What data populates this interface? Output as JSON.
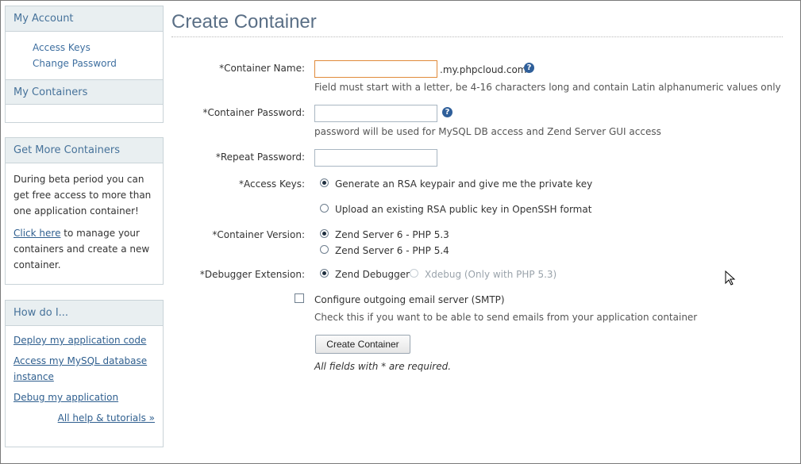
{
  "sidebar": {
    "account": {
      "title": "My Account",
      "links": [
        "Access Keys",
        "Change Password"
      ]
    },
    "containers": {
      "title": "My Containers"
    },
    "get_more": {
      "title": "Get More Containers",
      "text": "During beta period you can get free access to more than one application container!",
      "link": "Click here",
      "text_after": " to manage your containers and create a new container."
    },
    "how_do_i": {
      "title": "How do I...",
      "links": [
        "Deploy my application code",
        "Access my MySQL database instance",
        "Debug my application"
      ],
      "all_help": "All help & tutorials »"
    }
  },
  "main": {
    "title": "Create Container",
    "container_name": {
      "label": "*Container Name:",
      "value": "",
      "suffix": ".my.phpcloud.com",
      "hint": "Field must start with a letter, be 4-16 characters long and contain Latin alphanumeric values only"
    },
    "container_password": {
      "label": "*Container Password:",
      "value": "",
      "hint": "password will be used for MySQL DB access and Zend Server GUI access"
    },
    "repeat_password": {
      "label": "*Repeat Password:",
      "value": ""
    },
    "access_keys": {
      "label": "*Access Keys:",
      "options": [
        "Generate an RSA keypair and give me the private key",
        "Upload an existing RSA public key in OpenSSH format"
      ],
      "selected": 0
    },
    "container_version": {
      "label": "*Container Version:",
      "options": [
        "Zend Server 6 - PHP 5.3",
        "Zend Server 6 - PHP 5.4"
      ],
      "selected": 0
    },
    "debugger": {
      "label": "*Debugger Extension:",
      "options": [
        "Zend Debugger",
        "Xdebug (Only with PHP 5.3)"
      ],
      "selected": 0
    },
    "smtp": {
      "label": "Configure outgoing email server (SMTP)",
      "hint": "Check this if you want to be able to send emails from your application container",
      "checked": false
    },
    "submit_label": "Create Container",
    "required_note": "All fields with * are required."
  },
  "icons": {
    "help": "help-icon",
    "cursor": "mouse-cursor-icon"
  },
  "colors": {
    "accent": "#46729a",
    "link": "#2f5f8f",
    "panel_header": "#e9eff1",
    "focus_border": "#e08a3a"
  }
}
